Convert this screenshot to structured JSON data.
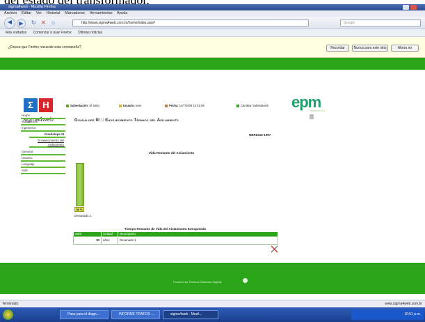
{
  "caption": "del estado del transformador.",
  "browser": {
    "title": "sigma4web - Mozilla Firefox",
    "menu": [
      "Archivo",
      "Editar",
      "Ver",
      "Historial",
      "Marcadores",
      "Herramientas",
      "Ayuda"
    ],
    "url": "http://www.sigma4web.com.br/home/index.asp#",
    "search_placeholder": "Google",
    "bookmarks": [
      "Más visitados",
      "Comenzar a usar Firefox",
      "Últimas noticias"
    ],
    "notification": "¿Desea que Firefox recuerde esta contraseña?",
    "notif_buttons": [
      "Recordar",
      "Nunca para este sitio",
      "Ahora no"
    ],
    "status": "Terminado",
    "status_right": "www.sigma4web.com.br"
  },
  "page": {
    "brand": "sigma4web",
    "logo_letters": [
      "Σ",
      "H"
    ],
    "epm": "epm",
    "epm_sub": "estamos ahí.",
    "info": {
      "subestacion_label": "Subestación:",
      "subestacion_value": "El Salto",
      "usuario_label": "Usuario:",
      "usuario_value": "epm",
      "fecha_label": "Fecha:",
      "fecha_value": "14/7/2009 14:51:59",
      "cambiar": "Cambiar Subestación"
    },
    "title": "Guadalupe III :: Envejecimiento Térmico del Aislamiento",
    "norma": "NBR5416-1997",
    "sidebar": [
      "Home",
      "Supervisión",
      "Ingeniería",
      "Guadalupe III",
      "Envejecimiento del Aislamiento",
      "General",
      "Usuario",
      "Lenguaje",
      "Salir"
    ],
    "section_title": "Vida Restante del Aislamiento",
    "bar_value_label": "98 %",
    "bar_fraction": 0.98,
    "bar_label": "Devanado 1",
    "table_title": "Tiempo Restante de Vida del Aislamiento Extrapolado",
    "table": {
      "headers": [
        "Valor",
        "Unidad",
        "Descripción"
      ],
      "rows": [
        [
          "30",
          "años",
          "Devanado 1"
        ]
      ]
    },
    "footer": "Powered by Treetech Sistemas Digitais"
  },
  "taskbar": {
    "tasks": [
      "Paso para el diagn...",
      "INFORME TRAFOS -...",
      "sigma4web - Mozil..."
    ],
    "clock": "10:51 p.m."
  },
  "colors": {
    "green": "#2aa618",
    "bar": "#8bc53f",
    "epm": "#21a06b",
    "red": "#d9262b",
    "blue": "#1f6fc2"
  }
}
